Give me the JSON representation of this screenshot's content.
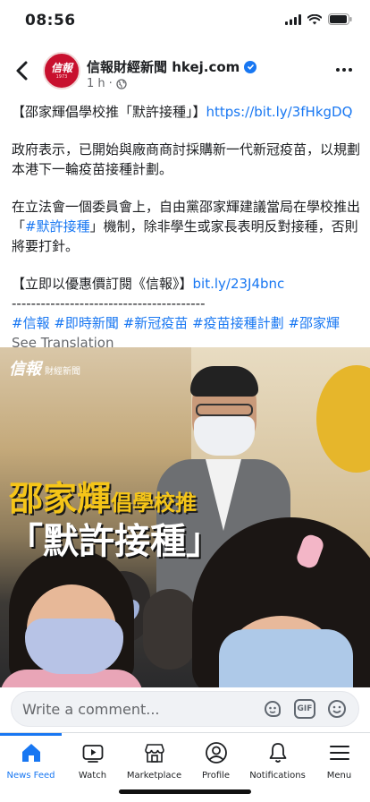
{
  "status": {
    "time": "08:56"
  },
  "header": {
    "page_name": "信報財經新聞 hkej.com",
    "time_ago": "1 h",
    "avatar_text": "信報",
    "avatar_year": "1973"
  },
  "post": {
    "line1_title": "【邵家輝倡學校推「默許接種」】",
    "line1_link": "https://bit.ly/3fHkgDQ",
    "para1": "政府表示，已開始與廠商商討採購新一代新冠疫苗，以規劃本港下一輪疫苗接種計劃。",
    "para2_pre": "在立法會一個委員會上，自由黨邵家輝建議當局在學校推出「",
    "para2_tag": "#默許接種",
    "para2_post": "」機制，除非學生或家長表明反對接種，否則將要打針。",
    "para3_title": "【立即以優惠價訂閱《信報》】",
    "para3_link": "bit.ly/23J4bnc",
    "divider": "----------------------------------------",
    "hashtags": [
      "#信報",
      "#即時新聞",
      "#新冠疫苗",
      "#疫苗接種計劃",
      "#邵家輝"
    ],
    "see_translation": "See Translation"
  },
  "image": {
    "logo_main": "信報",
    "logo_sub": "財經新聞",
    "headline_big": "邵家輝",
    "headline_small": "倡學校推",
    "headline2": "「默許接種」"
  },
  "comment": {
    "placeholder": "Write a comment..."
  },
  "tabs": [
    {
      "label": "News Feed",
      "icon": "home-icon",
      "active": true
    },
    {
      "label": "Watch",
      "icon": "watch-icon",
      "active": false
    },
    {
      "label": "Marketplace",
      "icon": "marketplace-icon",
      "active": false
    },
    {
      "label": "Profile",
      "icon": "profile-icon",
      "active": false
    },
    {
      "label": "Notifications",
      "icon": "bell-icon",
      "active": false
    },
    {
      "label": "Menu",
      "icon": "menu-icon",
      "active": false
    }
  ],
  "colors": {
    "accent": "#1877f2",
    "headline_yellow": "#f5c518",
    "brand_red": "#c8102e"
  }
}
